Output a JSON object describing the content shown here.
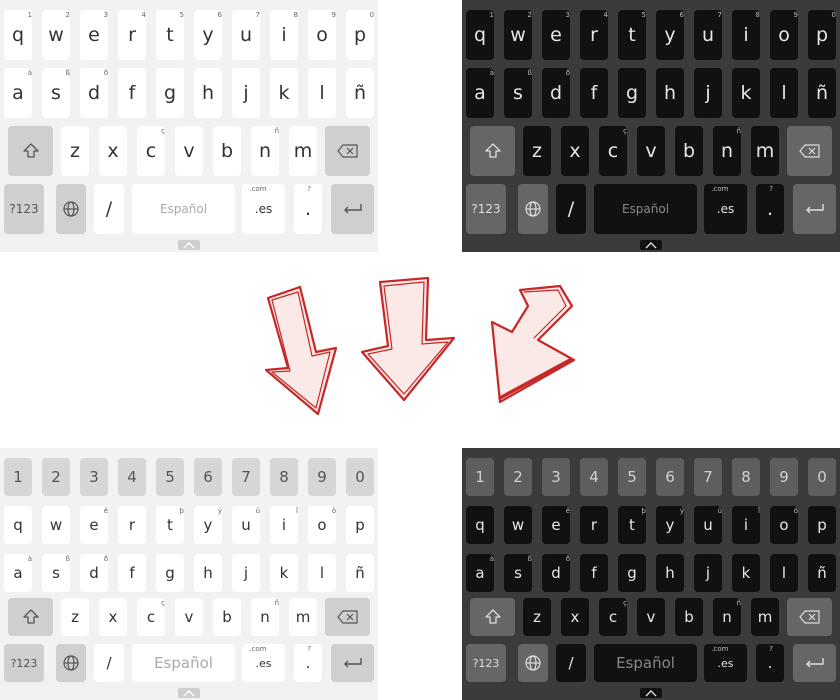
{
  "keyboards": [
    {
      "id": "top-left",
      "theme": "light",
      "language_label": "Español",
      "rows": {
        "row1": [
          {
            "label": "q",
            "sup": "1"
          },
          {
            "label": "w",
            "sup": "2"
          },
          {
            "label": "e",
            "sup": "3"
          },
          {
            "label": "r",
            "sup": "4"
          },
          {
            "label": "t",
            "sup": "5"
          },
          {
            "label": "y",
            "sup": "6"
          },
          {
            "label": "u",
            "sup": "7"
          },
          {
            "label": "i",
            "sup": "8"
          },
          {
            "label": "o",
            "sup": "9"
          },
          {
            "label": "p",
            "sup": "0"
          }
        ],
        "row2": [
          {
            "label": "a",
            "sup": "à"
          },
          {
            "label": "s",
            "sup": "ß"
          },
          {
            "label": "d",
            "sup": "ð"
          },
          {
            "label": "f",
            "sup": ""
          },
          {
            "label": "g",
            "sup": ""
          },
          {
            "label": "h",
            "sup": ""
          },
          {
            "label": "j",
            "sup": ""
          },
          {
            "label": "k",
            "sup": ""
          },
          {
            "label": "l",
            "sup": ""
          },
          {
            "label": "ñ",
            "sup": ""
          }
        ],
        "row3": [
          {
            "label": "z",
            "sup": ""
          },
          {
            "label": "x",
            "sup": ""
          },
          {
            "label": "c",
            "sup": "ç"
          },
          {
            "label": "v",
            "sup": ""
          },
          {
            "label": "b",
            "sup": ""
          },
          {
            "label": "n",
            "sup": "ñ"
          },
          {
            "label": "m",
            "sup": ""
          }
        ]
      },
      "bottom": {
        "symbols": "?123",
        "slash": "/",
        "domain": ".es",
        "domain_sup": ".com",
        "period": ".",
        "period_sup": "?"
      }
    },
    {
      "id": "top-right",
      "theme": "dark",
      "language_label": "Español",
      "rows": {
        "row1": [
          {
            "label": "q",
            "sup": "1"
          },
          {
            "label": "w",
            "sup": "2"
          },
          {
            "label": "e",
            "sup": "3"
          },
          {
            "label": "r",
            "sup": "4"
          },
          {
            "label": "t",
            "sup": "5"
          },
          {
            "label": "y",
            "sup": "6"
          },
          {
            "label": "u",
            "sup": "7"
          },
          {
            "label": "i",
            "sup": "8"
          },
          {
            "label": "o",
            "sup": "9"
          },
          {
            "label": "p",
            "sup": "0"
          }
        ],
        "row2": [
          {
            "label": "a",
            "sup": "à"
          },
          {
            "label": "s",
            "sup": "ß"
          },
          {
            "label": "d",
            "sup": "ð"
          },
          {
            "label": "f",
            "sup": ""
          },
          {
            "label": "g",
            "sup": ""
          },
          {
            "label": "h",
            "sup": ""
          },
          {
            "label": "j",
            "sup": ""
          },
          {
            "label": "k",
            "sup": ""
          },
          {
            "label": "l",
            "sup": ""
          },
          {
            "label": "ñ",
            "sup": ""
          }
        ],
        "row3": [
          {
            "label": "z",
            "sup": ""
          },
          {
            "label": "x",
            "sup": ""
          },
          {
            "label": "c",
            "sup": "ç"
          },
          {
            "label": "v",
            "sup": ""
          },
          {
            "label": "b",
            "sup": ""
          },
          {
            "label": "n",
            "sup": "ñ"
          },
          {
            "label": "m",
            "sup": ""
          }
        ]
      },
      "bottom": {
        "symbols": "?123",
        "slash": "/",
        "domain": ".es",
        "domain_sup": ".com",
        "period": ".",
        "period_sup": "?"
      }
    },
    {
      "id": "bottom-left",
      "theme": "light",
      "language_label": "Español",
      "numbers": [
        "1",
        "2",
        "3",
        "4",
        "5",
        "6",
        "7",
        "8",
        "9",
        "0"
      ],
      "rows": {
        "row1": [
          {
            "label": "q",
            "sup": ""
          },
          {
            "label": "w",
            "sup": ""
          },
          {
            "label": "e",
            "sup": "ê"
          },
          {
            "label": "r",
            "sup": ""
          },
          {
            "label": "t",
            "sup": "þ"
          },
          {
            "label": "y",
            "sup": "ý"
          },
          {
            "label": "u",
            "sup": "û"
          },
          {
            "label": "i",
            "sup": "î"
          },
          {
            "label": "o",
            "sup": "ô"
          },
          {
            "label": "p",
            "sup": ""
          }
        ],
        "row2": [
          {
            "label": "a",
            "sup": "à"
          },
          {
            "label": "s",
            "sup": "ß"
          },
          {
            "label": "d",
            "sup": "ð"
          },
          {
            "label": "f",
            "sup": ""
          },
          {
            "label": "g",
            "sup": ""
          },
          {
            "label": "h",
            "sup": ""
          },
          {
            "label": "j",
            "sup": ""
          },
          {
            "label": "k",
            "sup": ""
          },
          {
            "label": "l",
            "sup": ""
          },
          {
            "label": "ñ",
            "sup": ""
          }
        ],
        "row3": [
          {
            "label": "z",
            "sup": ""
          },
          {
            "label": "x",
            "sup": ""
          },
          {
            "label": "c",
            "sup": "ç"
          },
          {
            "label": "v",
            "sup": ""
          },
          {
            "label": "b",
            "sup": ""
          },
          {
            "label": "n",
            "sup": "ñ"
          },
          {
            "label": "m",
            "sup": ""
          }
        ]
      },
      "bottom": {
        "symbols": "?123",
        "slash": "/",
        "domain": ".es",
        "domain_sup": ".com",
        "period": ".",
        "period_sup": "?"
      }
    },
    {
      "id": "bottom-right",
      "theme": "dark",
      "language_label": "Español",
      "numbers": [
        "1",
        "2",
        "3",
        "4",
        "5",
        "6",
        "7",
        "8",
        "9",
        "0"
      ],
      "rows": {
        "row1": [
          {
            "label": "q",
            "sup": ""
          },
          {
            "label": "w",
            "sup": ""
          },
          {
            "label": "e",
            "sup": "ê"
          },
          {
            "label": "r",
            "sup": ""
          },
          {
            "label": "t",
            "sup": "þ"
          },
          {
            "label": "y",
            "sup": "ý"
          },
          {
            "label": "u",
            "sup": "û"
          },
          {
            "label": "i",
            "sup": "î"
          },
          {
            "label": "o",
            "sup": "ô"
          },
          {
            "label": "p",
            "sup": ""
          }
        ],
        "row2": [
          {
            "label": "a",
            "sup": "à"
          },
          {
            "label": "s",
            "sup": "ß"
          },
          {
            "label": "d",
            "sup": "ð"
          },
          {
            "label": "f",
            "sup": ""
          },
          {
            "label": "g",
            "sup": ""
          },
          {
            "label": "h",
            "sup": ""
          },
          {
            "label": "j",
            "sup": ""
          },
          {
            "label": "k",
            "sup": ""
          },
          {
            "label": "l",
            "sup": ""
          },
          {
            "label": "ñ",
            "sup": ""
          }
        ],
        "row3": [
          {
            "label": "z",
            "sup": ""
          },
          {
            "label": "x",
            "sup": ""
          },
          {
            "label": "c",
            "sup": "ç"
          },
          {
            "label": "v",
            "sup": ""
          },
          {
            "label": "b",
            "sup": ""
          },
          {
            "label": "n",
            "sup": "ñ"
          },
          {
            "label": "m",
            "sup": ""
          }
        ]
      },
      "bottom": {
        "symbols": "?123",
        "slash": "/",
        "domain": ".es",
        "domain_sup": ".com",
        "period": ".",
        "period_sup": "?"
      }
    }
  ],
  "icons": {
    "shift": "shift-icon",
    "backspace": "backspace-icon",
    "globe": "globe-icon",
    "enter": "enter-icon",
    "handle": "chevron-up-icon",
    "arrows": "hand-drawn-arrow-icon"
  },
  "colors": {
    "arrow": "#c62828",
    "light_bg": "#f2f2f2",
    "dark_bg": "#3b3b3b"
  }
}
